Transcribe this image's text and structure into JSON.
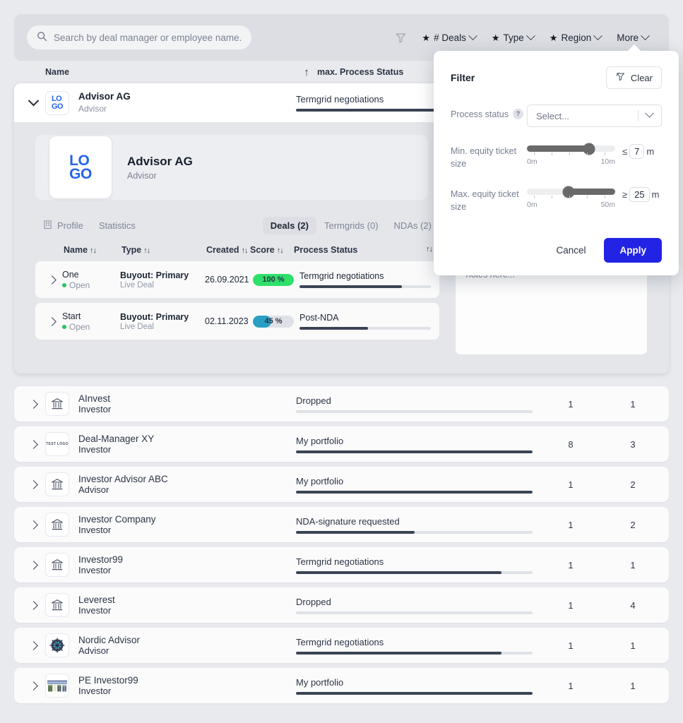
{
  "search": {
    "placeholder": "Search by deal manager or employee name...",
    "value": "",
    "icon": "search-icon"
  },
  "toolbar": {
    "funnel_icon": "funnel-icon",
    "chips": [
      {
        "label": "# Deals",
        "starred": true
      },
      {
        "label": "Type",
        "starred": true
      },
      {
        "label": "Region",
        "starred": true
      },
      {
        "label": "More",
        "starred": false
      }
    ]
  },
  "columns": {
    "name": "Name",
    "sort_arrow": "↑",
    "process_status": "max. Process Status"
  },
  "expanded": {
    "row": {
      "name": "Advisor AG",
      "subtitle": "Advisor",
      "logo": "LOGO",
      "status_label": "Termgrid negotiations",
      "status_pct": 78
    },
    "profile": {
      "logo_line1": "LO",
      "logo_line2": "GO",
      "name": "Advisor AG",
      "subtitle": "Advisor"
    },
    "tabs": [
      {
        "label": "Profile",
        "active": false,
        "icon": "building-icon"
      },
      {
        "label": "Statistics",
        "active": false
      },
      {
        "label": "Deals (2)",
        "active": true
      },
      {
        "label": "Termgrids (0)",
        "active": false
      },
      {
        "label": "NDAs (2)",
        "active": false
      }
    ],
    "deal_columns": {
      "name": "Name",
      "type": "Type",
      "created": "Created",
      "score": "Score",
      "process_status": "Process Status",
      "sort_icon": "↑↓"
    },
    "deals": [
      {
        "name": "One",
        "state": "Open",
        "type": "Buyout: Primary",
        "type_sub": "Live Deal",
        "created": "26.09.2021",
        "score": "100 %",
        "score_pct": 100,
        "score_color": "#2ee06a",
        "status_label": "Termgrid negotiations",
        "status_pct": 78
      },
      {
        "name": "Start",
        "state": "Open",
        "type": "Buyout: Primary",
        "type_sub": "Live Deal",
        "created": "02.11.2023",
        "score": "45 %",
        "score_pct": 45,
        "score_color": "#2a9fc4",
        "status_label": "Post-NDA",
        "status_pct": 52
      }
    ],
    "notes_placeholder": "Type your internal deal manager specific notes here...",
    "notes_value": ""
  },
  "rows": [
    {
      "name": "AInvest",
      "subtitle": "Investor",
      "logo": "bank",
      "status_label": "Dropped",
      "status_pct": 0,
      "deals": "1",
      "region": "1"
    },
    {
      "name": "Deal-Manager XY",
      "subtitle": "Investor",
      "logo": "testlogo",
      "status_label": "My portfolio",
      "status_pct": 100,
      "deals": "8",
      "region": "3"
    },
    {
      "name": "Investor Advisor ABC",
      "subtitle": "Advisor",
      "logo": "bank",
      "status_label": "My portfolio",
      "status_pct": 100,
      "deals": "1",
      "region": "2"
    },
    {
      "name": "Investor Company",
      "subtitle": "Investor",
      "logo": "bank",
      "status_label": "NDA-signature requested",
      "status_pct": 50,
      "deals": "1",
      "region": "2"
    },
    {
      "name": "Investor99",
      "subtitle": "Investor",
      "logo": "bank",
      "status_label": "Termgrid negotiations",
      "status_pct": 87,
      "deals": "1",
      "region": "1"
    },
    {
      "name": "Leverest",
      "subtitle": "Investor",
      "logo": "bank",
      "status_label": "Dropped",
      "status_pct": 0,
      "deals": "1",
      "region": "4"
    },
    {
      "name": "Nordic Advisor",
      "subtitle": "Advisor",
      "logo": "globe",
      "status_label": "Termgrid negotiations",
      "status_pct": 87,
      "deals": "1",
      "region": "1"
    },
    {
      "name": "PE Investor99",
      "subtitle": "Investor",
      "logo": "building",
      "status_label": "My portfolio",
      "status_pct": 100,
      "deals": "1",
      "region": "1"
    }
  ],
  "filter_popup": {
    "title": "Filter",
    "clear_label": "Clear",
    "clear_icon": "funnel-clear-icon",
    "process_status": {
      "label": "Process status",
      "help": "?",
      "placeholder": "Select...",
      "value": ""
    },
    "min_ticket": {
      "label": "Min. equity ticket size",
      "min_label": "0m",
      "max_label": "10m",
      "operator": "≤",
      "value": "7",
      "unit": "m",
      "position_pct": 70,
      "fill_from": 0,
      "fill_to": 70
    },
    "max_ticket": {
      "label": "Max. equity ticket size",
      "min_label": "0m",
      "max_label": "50m",
      "operator": "≥",
      "value": "25",
      "unit": "m",
      "position_pct": 47,
      "fill_from": 47,
      "fill_to": 100
    },
    "cancel_label": "Cancel",
    "apply_label": "Apply",
    "apply_color": "#2323e6"
  }
}
